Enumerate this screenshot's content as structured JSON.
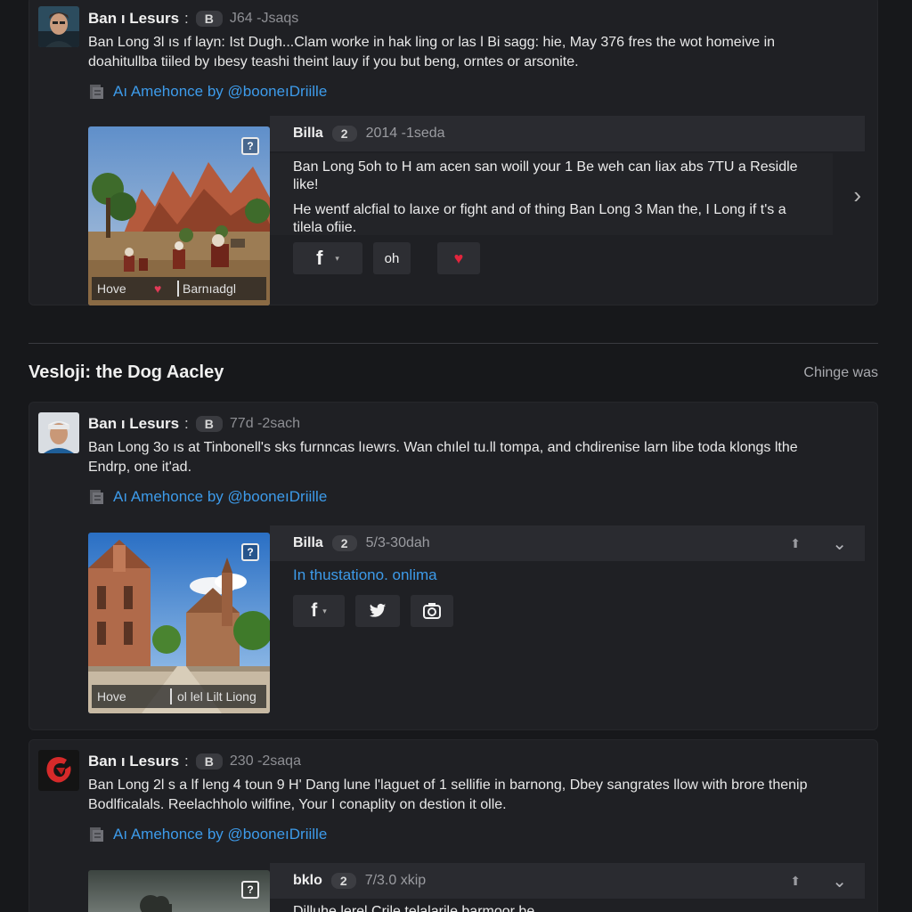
{
  "posts": [
    {
      "author": "Ban ı Lesurs",
      "badge": "B",
      "meta": "J64 -Jsaqs",
      "text": "Ban Long 3l ıs ıf layn: Ist Dugh...Clam worke in hak ling or las l Bi sagg: hie, May 376 fres the wot homeive in doahitullba tiiled by ıbesy teashi theint lauy if you but beng, orntes or arsonite.",
      "link": "Aı Amehonce by @booneıDriille",
      "inner": {
        "name": "Billa",
        "badge": "2",
        "meta": "2014 -1seda",
        "para1": "Ban Long 5oh to H am acen san woill your 1 Be weh can liax abs 7TU a Residle like!",
        "para2": "He wentf alcfial to laıxe or fight and of thing Ban Long 3 Man the, I Long if t's a tilela ofiie.",
        "thumb_left": "Hove",
        "thumb_right": "Barnıadgl",
        "btn1": "f",
        "btn2": "oh"
      }
    },
    {
      "author": "Ban ı Lesurs",
      "badge": "B",
      "meta": "77d -2sach",
      "text": "Ban Long 3o ıs at Tinbonell's sks furnncas lıewrs. Wan chılel tu.ll tompa, and chdirenise larn libe toda klongs lthe Endrp, one it'ad.",
      "link": "Aı Amehonce by @booneıDriille",
      "inner": {
        "name": "Billa",
        "badge": "2",
        "meta": "5/3-30dah",
        "subtitle": "In thustationo. onlima",
        "thumb_left": "Hove",
        "thumb_right": "ol lel Lilt Liong"
      }
    },
    {
      "author": "Ban ı Lesurs",
      "badge": "B",
      "meta": "230 -2saqa",
      "text": "Ban Long 2l s a lf leng 4 toun 9 H' Dang lune l'laguet of 1 sellifie in barnong, Dbey sangrates llow with brore thenip Bodlficalals. Reelachholo wilfine, Your I conaplity on destion it olle.",
      "link": "Aı Amehonce by @booneıDriille",
      "inner": {
        "name": "bklo",
        "badge": "2",
        "meta": "7/3.0 xkip",
        "preview": "Dilluhe lerel Crile telalarile barmoor be"
      }
    }
  ],
  "section": {
    "title": "Vesloji: the Dog Aacley",
    "link": "Chinge was"
  }
}
